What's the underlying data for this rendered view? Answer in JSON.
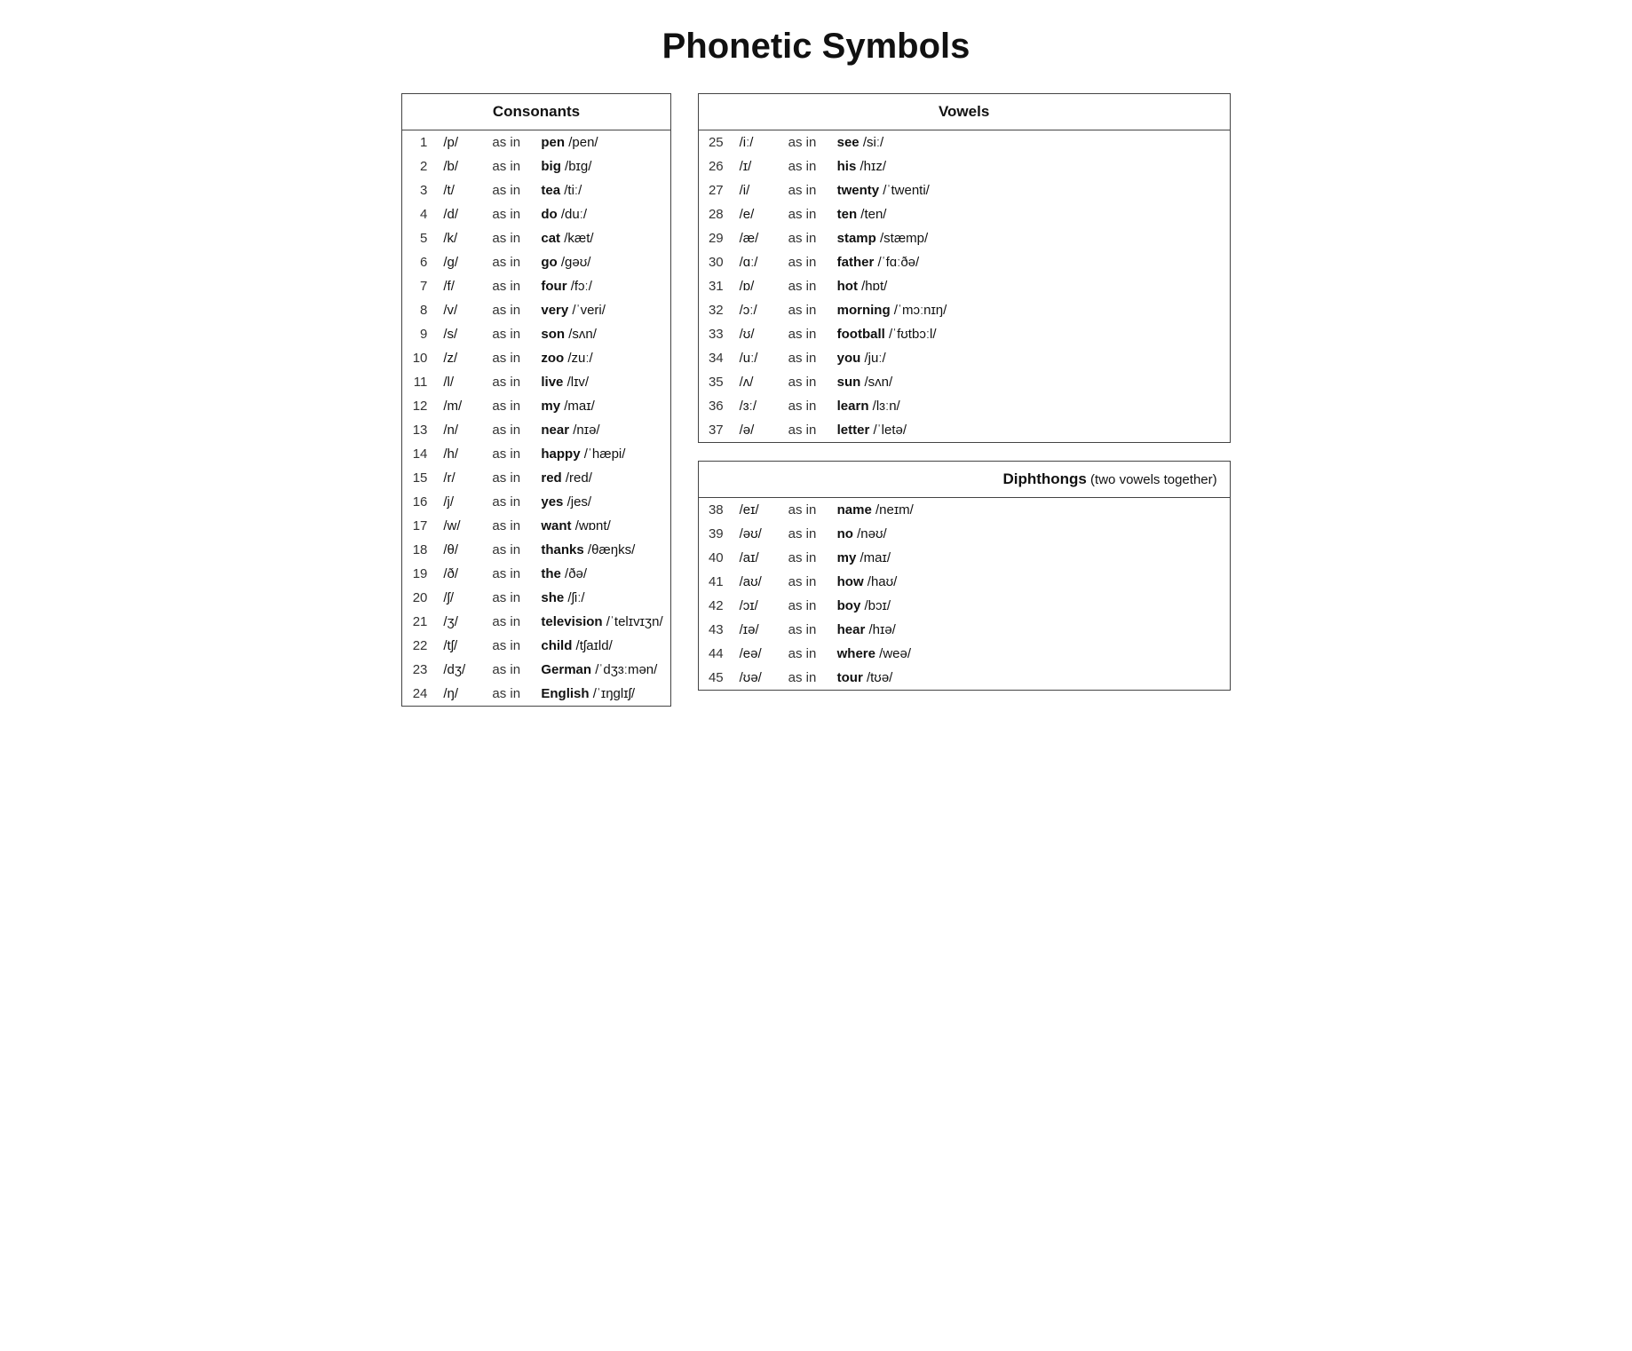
{
  "title": "Phonetic Symbols",
  "consonants": {
    "header": "Consonants",
    "rows": [
      {
        "num": "1",
        "symbol": "/p/",
        "asin": "as in",
        "word": "pen",
        "phonetic": "/pen/"
      },
      {
        "num": "2",
        "symbol": "/b/",
        "asin": "as in",
        "word": "big",
        "phonetic": "/bɪg/"
      },
      {
        "num": "3",
        "symbol": "/t/",
        "asin": "as in",
        "word": "tea",
        "phonetic": "/tiː/"
      },
      {
        "num": "4",
        "symbol": "/d/",
        "asin": "as in",
        "word": "do",
        "phonetic": "/duː/"
      },
      {
        "num": "5",
        "symbol": "/k/",
        "asin": "as in",
        "word": "cat",
        "phonetic": "/kæt/"
      },
      {
        "num": "6",
        "symbol": "/g/",
        "asin": "as in",
        "word": "go",
        "phonetic": "/gəʊ/"
      },
      {
        "num": "7",
        "symbol": "/f/",
        "asin": "as in",
        "word": "four",
        "phonetic": "/fɔː/"
      },
      {
        "num": "8",
        "symbol": "/v/",
        "asin": "as in",
        "word": "very",
        "phonetic": "/ˈveri/"
      },
      {
        "num": "9",
        "symbol": "/s/",
        "asin": "as in",
        "word": "son",
        "phonetic": "/sʌn/"
      },
      {
        "num": "10",
        "symbol": "/z/",
        "asin": "as in",
        "word": "zoo",
        "phonetic": "/zuː/"
      },
      {
        "num": "11",
        "symbol": "/l/",
        "asin": "as in",
        "word": "live",
        "phonetic": "/lɪv/"
      },
      {
        "num": "12",
        "symbol": "/m/",
        "asin": "as in",
        "word": "my",
        "phonetic": "/maɪ/"
      },
      {
        "num": "13",
        "symbol": "/n/",
        "asin": "as in",
        "word": "near",
        "phonetic": "/nɪə/"
      },
      {
        "num": "14",
        "symbol": "/h/",
        "asin": "as in",
        "word": "happy",
        "phonetic": "/ˈhæpi/"
      },
      {
        "num": "15",
        "symbol": "/r/",
        "asin": "as in",
        "word": "red",
        "phonetic": "/red/"
      },
      {
        "num": "16",
        "symbol": "/j/",
        "asin": "as in",
        "word": "yes",
        "phonetic": "/jes/"
      },
      {
        "num": "17",
        "symbol": "/w/",
        "asin": "as in",
        "word": "want",
        "phonetic": "/wɒnt/"
      },
      {
        "num": "18",
        "symbol": "/θ/",
        "asin": "as in",
        "word": "thanks",
        "phonetic": "/θæŋks/"
      },
      {
        "num": "19",
        "symbol": "/ð/",
        "asin": "as in",
        "word": "the",
        "phonetic": "/ðə/"
      },
      {
        "num": "20",
        "symbol": "/ʃ/",
        "asin": "as in",
        "word": "she",
        "phonetic": "/ʃiː/"
      },
      {
        "num": "21",
        "symbol": "/ʒ/",
        "asin": "as in",
        "word": "television",
        "phonetic": "/ˈtelɪvɪʒn/"
      },
      {
        "num": "22",
        "symbol": "/tʃ/",
        "asin": "as in",
        "word": "child",
        "phonetic": "/tʃaɪld/"
      },
      {
        "num": "23",
        "symbol": "/dʒ/",
        "asin": "as in",
        "word": "German",
        "phonetic": "/ˈdʒɜːmən/"
      },
      {
        "num": "24",
        "symbol": "/ŋ/",
        "asin": "as in",
        "word": "English",
        "phonetic": "/ˈɪŋglɪʃ/"
      }
    ]
  },
  "vowels": {
    "header": "Vowels",
    "rows": [
      {
        "num": "25",
        "symbol": "/iː/",
        "asin": "as in",
        "word": "see",
        "phonetic": "/siː/"
      },
      {
        "num": "26",
        "symbol": "/ɪ/",
        "asin": "as in",
        "word": "his",
        "phonetic": "/hɪz/"
      },
      {
        "num": "27",
        "symbol": "/i/",
        "asin": "as in",
        "word": "twenty",
        "phonetic": "/ˈtwenti/"
      },
      {
        "num": "28",
        "symbol": "/e/",
        "asin": "as in",
        "word": "ten",
        "phonetic": "/ten/"
      },
      {
        "num": "29",
        "symbol": "/æ/",
        "asin": "as in",
        "word": "stamp",
        "phonetic": "/stæmp/"
      },
      {
        "num": "30",
        "symbol": "/ɑː/",
        "asin": "as in",
        "word": "father",
        "phonetic": "/ˈfɑːðə/"
      },
      {
        "num": "31",
        "symbol": "/ɒ/",
        "asin": "as in",
        "word": "hot",
        "phonetic": "/hɒt/"
      },
      {
        "num": "32",
        "symbol": "/ɔː/",
        "asin": "as in",
        "word": "morning",
        "phonetic": "/ˈmɔːnɪŋ/"
      },
      {
        "num": "33",
        "symbol": "/ʊ/",
        "asin": "as in",
        "word": "football",
        "phonetic": "/ˈfʊtbɔːl/"
      },
      {
        "num": "34",
        "symbol": "/uː/",
        "asin": "as in",
        "word": "you",
        "phonetic": "/juː/"
      },
      {
        "num": "35",
        "symbol": "/ʌ/",
        "asin": "as in",
        "word": "sun",
        "phonetic": "/sʌn/"
      },
      {
        "num": "36",
        "symbol": "/ɜː/",
        "asin": "as in",
        "word": "learn",
        "phonetic": "/lɜːn/"
      },
      {
        "num": "37",
        "symbol": "/ə/",
        "asin": "as in",
        "word": "letter",
        "phonetic": "/ˈletə/"
      }
    ]
  },
  "diphthongs": {
    "header": "Diphthongs",
    "subheader": " (two vowels together)",
    "rows": [
      {
        "num": "38",
        "symbol": "/eɪ/",
        "asin": "as in",
        "word": "name",
        "phonetic": "/neɪm/"
      },
      {
        "num": "39",
        "symbol": "/əʊ/",
        "asin": "as in",
        "word": "no",
        "phonetic": "/nəʊ/"
      },
      {
        "num": "40",
        "symbol": "/aɪ/",
        "asin": "as in",
        "word": "my",
        "phonetic": "/maɪ/"
      },
      {
        "num": "41",
        "symbol": "/aʊ/",
        "asin": "as in",
        "word": "how",
        "phonetic": "/haʊ/"
      },
      {
        "num": "42",
        "symbol": "/ɔɪ/",
        "asin": "as in",
        "word": "boy",
        "phonetic": "/bɔɪ/"
      },
      {
        "num": "43",
        "symbol": "/ɪə/",
        "asin": "as in",
        "word": "hear",
        "phonetic": "/hɪə/"
      },
      {
        "num": "44",
        "symbol": "/eə/",
        "asin": "as in",
        "word": "where",
        "phonetic": "/weə/"
      },
      {
        "num": "45",
        "symbol": "/ʊə/",
        "asin": "as in",
        "word": "tour",
        "phonetic": "/tʊə/"
      }
    ]
  }
}
